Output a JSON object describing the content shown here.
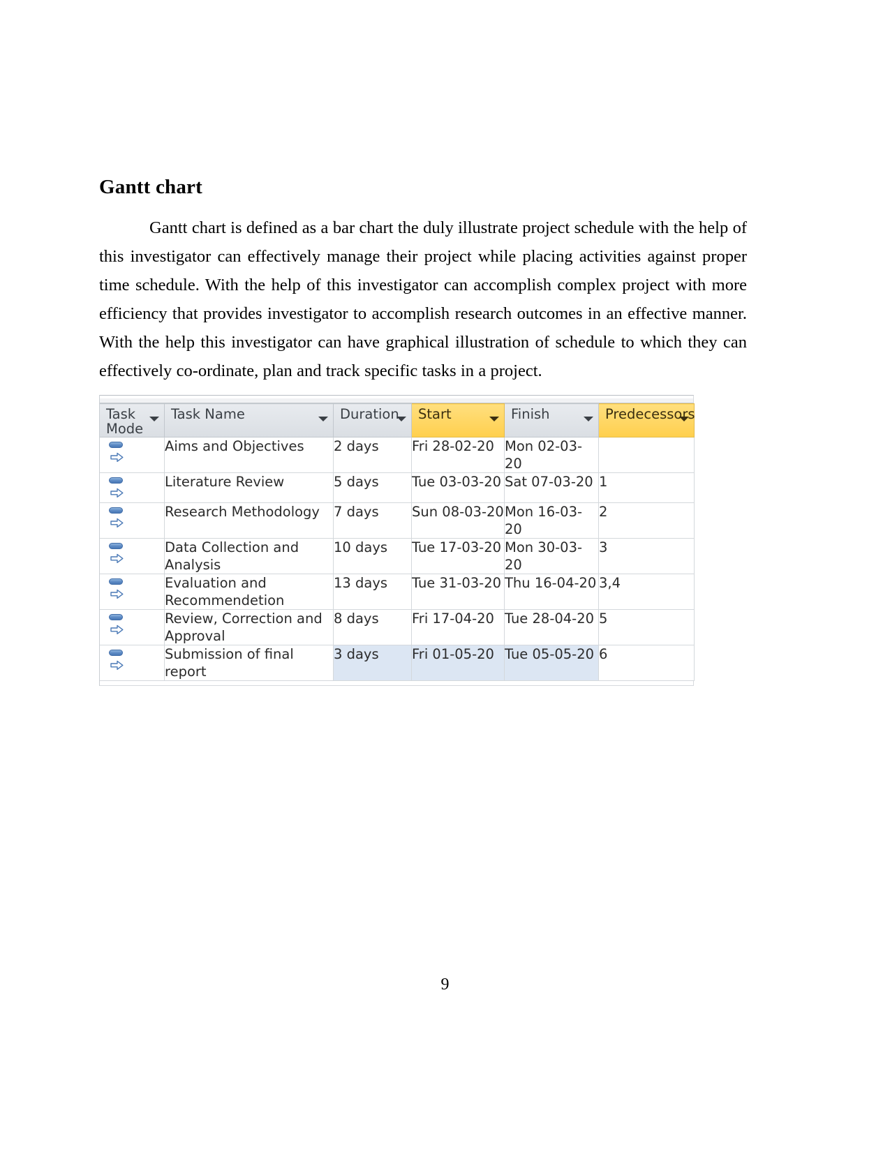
{
  "document": {
    "heading": "Gantt chart",
    "paragraph": "Gantt chart is defined as a bar chart the duly illustrate project schedule with the help of this investigator can effectively manage their project while placing activities against proper time schedule. With the help of this investigator can accomplish complex project with more efficiency that provides investigator to accomplish research outcomes in an effective manner. With the help this investigator can have graphical illustration of schedule to which they can effectively co-ordinate, plan and track specific tasks in a project.",
    "page_number": "9"
  },
  "colors": {
    "header_highlight": "#ffd966",
    "header_default": "#dfe3e8",
    "selected_row": "#dce6f3",
    "task_mode_icon": "#4a79b6",
    "grid_line": "#d4d8dc"
  },
  "project_table": {
    "columns": [
      {
        "label": "Task Mode",
        "highlighted": false,
        "has_filter": true
      },
      {
        "label": "Task Name",
        "highlighted": false,
        "has_filter": true
      },
      {
        "label": "Duration",
        "highlighted": false,
        "has_filter": true
      },
      {
        "label": "Start",
        "highlighted": true,
        "has_filter": true
      },
      {
        "label": "Finish",
        "highlighted": false,
        "has_filter": true
      },
      {
        "label": "Predecessors",
        "highlighted": true,
        "has_filter": true
      }
    ],
    "rows": [
      {
        "mode_icon": "manually-scheduled-icon",
        "task_name": "Aims and Objectives",
        "duration": "2 days",
        "start": "Fri 28-02-20",
        "finish": "Mon 02-03-20",
        "predecessors": "",
        "selected": false
      },
      {
        "mode_icon": "manually-scheduled-icon",
        "task_name": "Literature Review",
        "duration": "5 days",
        "start": "Tue 03-03-20",
        "finish": "Sat 07-03-20",
        "predecessors": "1",
        "selected": false
      },
      {
        "mode_icon": "manually-scheduled-icon",
        "task_name": "Research Methodology",
        "duration": "7 days",
        "start": "Sun 08-03-20",
        "finish": "Mon 16-03-20",
        "predecessors": "2",
        "selected": false
      },
      {
        "mode_icon": "manually-scheduled-icon",
        "task_name": "Data Collection and Analysis",
        "duration": "10 days",
        "start": "Tue 17-03-20",
        "finish": "Mon 30-03-20",
        "predecessors": "3",
        "selected": false
      },
      {
        "mode_icon": "manually-scheduled-icon",
        "task_name": "Evaluation and Recommendetion",
        "duration": "13 days",
        "start": "Tue 31-03-20",
        "finish": "Thu 16-04-20",
        "predecessors": "3,4",
        "selected": false
      },
      {
        "mode_icon": "manually-scheduled-icon",
        "task_name": "Review, Correction and Approval",
        "duration": "8 days",
        "start": "Fri 17-04-20",
        "finish": "Tue 28-04-20",
        "predecessors": "5",
        "selected": false
      },
      {
        "mode_icon": "manually-scheduled-icon",
        "task_name": "Submission of final report",
        "duration": "3 days",
        "start": "Fri 01-05-20",
        "finish": "Tue 05-05-20",
        "predecessors": "6",
        "selected": true
      }
    ]
  }
}
